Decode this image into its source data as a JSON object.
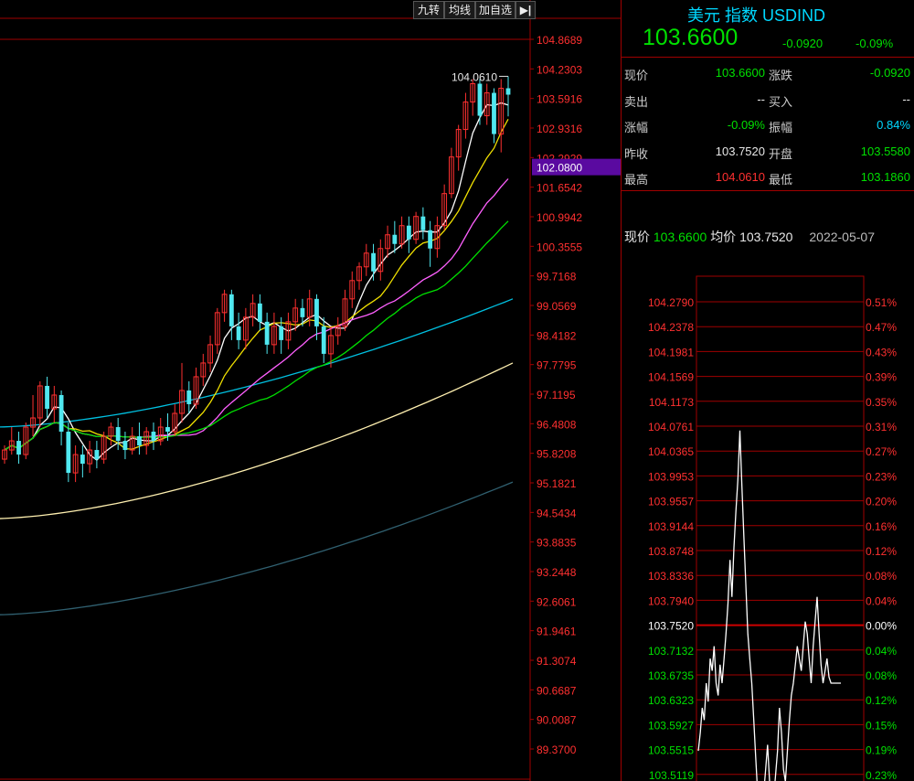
{
  "toolbar": {
    "btn1": "九转",
    "btn2": "均线",
    "btn3": "加自选",
    "btn4": "▶|"
  },
  "header": {
    "title": "美元 指数 USDIND",
    "price": "103.6600",
    "change": "-0.0920",
    "change_pct": "-0.09%"
  },
  "quote": {
    "rows": [
      {
        "l1": "现价",
        "v1": "103.6600",
        "c1": "green",
        "l2": "涨跌",
        "v2": "-0.0920",
        "c2": "green"
      },
      {
        "l1": "卖出",
        "v1": "--",
        "c1": "white",
        "l2": "买入",
        "v2": "--",
        "c2": "white"
      },
      {
        "l1": "涨幅",
        "v1": "-0.09%",
        "c1": "green",
        "l2": "振幅",
        "v2": "0.84%",
        "c2": "cyan"
      },
      {
        "l1": "昨收",
        "v1": "103.7520",
        "c1": "white",
        "l2": "开盘",
        "v2": "103.5580",
        "c2": "green"
      },
      {
        "l1": "最高",
        "v1": "104.0610",
        "c1": "red",
        "l2": "最低",
        "v2": "103.1860",
        "c2": "green"
      }
    ]
  },
  "intraday_header": {
    "now_label": "现价",
    "now_val": "103.6600",
    "avg_label": "均价",
    "avg_val": "103.7520",
    "date": "2022-05-07"
  },
  "colors": {
    "up": "#ff3030",
    "down": "#50e8f0",
    "grid": "#a00000",
    "ma5": "#ffffff",
    "ma10": "#f0e000",
    "ma20": "#ff60ff",
    "ma30": "#00e000",
    "ma60": "#00c0e0",
    "ma120": "#fff0b0",
    "ma250": "#306070"
  },
  "chart_data": [
    {
      "type": "candlestick",
      "title": "",
      "y_ticks": [
        "104.8689",
        "104.2303",
        "103.5916",
        "102.9316",
        "102.2929",
        "101.6542",
        "100.9942",
        "100.3555",
        "99.7168",
        "99.0569",
        "98.4182",
        "97.7795",
        "97.1195",
        "96.4808",
        "95.8208",
        "95.1821",
        "94.5434",
        "93.8835",
        "93.2448",
        "92.6061",
        "91.9461",
        "91.3074",
        "90.6687",
        "90.0087",
        "89.3700"
      ],
      "ylim": [
        89.37,
        104.8689
      ],
      "highlight_label": "102.0800",
      "high_marker": "104.0610",
      "candles": [
        {
          "o": 95.7,
          "c": 95.9,
          "h": 96.0,
          "l": 95.6
        },
        {
          "o": 95.9,
          "c": 96.1,
          "h": 96.4,
          "l": 95.8
        },
        {
          "o": 96.1,
          "c": 95.8,
          "h": 96.3,
          "l": 95.6
        },
        {
          "o": 95.8,
          "c": 96.4,
          "h": 96.5,
          "l": 95.7
        },
        {
          "o": 96.4,
          "c": 96.6,
          "h": 97.1,
          "l": 96.2
        },
        {
          "o": 96.6,
          "c": 97.3,
          "h": 97.4,
          "l": 96.4
        },
        {
          "o": 97.3,
          "c": 96.8,
          "h": 97.5,
          "l": 96.6
        },
        {
          "o": 96.8,
          "c": 97.1,
          "h": 97.3,
          "l": 96.5
        },
        {
          "o": 97.1,
          "c": 96.3,
          "h": 97.2,
          "l": 96.0
        },
        {
          "o": 96.3,
          "c": 95.4,
          "h": 96.5,
          "l": 95.2
        },
        {
          "o": 95.4,
          "c": 95.8,
          "h": 96.0,
          "l": 95.2
        },
        {
          "o": 95.8,
          "c": 95.6,
          "h": 96.0,
          "l": 95.3
        },
        {
          "o": 95.6,
          "c": 95.9,
          "h": 96.1,
          "l": 95.4
        },
        {
          "o": 95.9,
          "c": 95.7,
          "h": 96.1,
          "l": 95.5
        },
        {
          "o": 95.7,
          "c": 96.2,
          "h": 96.3,
          "l": 95.6
        },
        {
          "o": 96.2,
          "c": 96.4,
          "h": 96.5,
          "l": 96.0
        },
        {
          "o": 96.4,
          "c": 96.1,
          "h": 96.6,
          "l": 95.9
        },
        {
          "o": 96.1,
          "c": 95.9,
          "h": 96.3,
          "l": 95.7
        },
        {
          "o": 95.9,
          "c": 96.2,
          "h": 96.4,
          "l": 95.8
        },
        {
          "o": 96.2,
          "c": 96.0,
          "h": 96.5,
          "l": 95.8
        },
        {
          "o": 96.0,
          "c": 96.3,
          "h": 96.4,
          "l": 95.8
        },
        {
          "o": 96.3,
          "c": 96.1,
          "h": 96.5,
          "l": 95.9
        },
        {
          "o": 96.1,
          "c": 96.4,
          "h": 96.6,
          "l": 96.0
        },
        {
          "o": 96.4,
          "c": 96.3,
          "h": 96.7,
          "l": 96.1
        },
        {
          "o": 96.3,
          "c": 96.7,
          "h": 96.9,
          "l": 96.2
        },
        {
          "o": 96.7,
          "c": 97.2,
          "h": 97.8,
          "l": 96.5
        },
        {
          "o": 97.2,
          "c": 96.9,
          "h": 97.4,
          "l": 96.7
        },
        {
          "o": 96.9,
          "c": 97.5,
          "h": 97.7,
          "l": 96.8
        },
        {
          "o": 97.5,
          "c": 97.8,
          "h": 98.0,
          "l": 97.3
        },
        {
          "o": 97.8,
          "c": 98.2,
          "h": 98.4,
          "l": 97.6
        },
        {
          "o": 98.2,
          "c": 98.9,
          "h": 99.0,
          "l": 98.0
        },
        {
          "o": 98.9,
          "c": 99.3,
          "h": 99.4,
          "l": 98.7
        },
        {
          "o": 99.3,
          "c": 98.6,
          "h": 99.4,
          "l": 98.3
        },
        {
          "o": 98.6,
          "c": 98.3,
          "h": 98.9,
          "l": 98.1
        },
        {
          "o": 98.3,
          "c": 98.8,
          "h": 99.0,
          "l": 98.1
        },
        {
          "o": 98.8,
          "c": 99.1,
          "h": 99.3,
          "l": 98.6
        },
        {
          "o": 99.1,
          "c": 98.7,
          "h": 99.3,
          "l": 98.5
        },
        {
          "o": 98.7,
          "c": 98.2,
          "h": 98.9,
          "l": 98.0
        },
        {
          "o": 98.2,
          "c": 98.6,
          "h": 98.9,
          "l": 98.0
        },
        {
          "o": 98.6,
          "c": 98.3,
          "h": 98.8,
          "l": 98.0
        },
        {
          "o": 98.3,
          "c": 98.7,
          "h": 98.9,
          "l": 98.1
        },
        {
          "o": 98.7,
          "c": 99.0,
          "h": 99.2,
          "l": 98.5
        },
        {
          "o": 99.0,
          "c": 98.8,
          "h": 99.2,
          "l": 98.6
        },
        {
          "o": 98.8,
          "c": 99.2,
          "h": 99.4,
          "l": 98.6
        },
        {
          "o": 99.2,
          "c": 98.6,
          "h": 99.3,
          "l": 98.3
        },
        {
          "o": 98.6,
          "c": 98.0,
          "h": 98.8,
          "l": 97.8
        },
        {
          "o": 98.0,
          "c": 98.4,
          "h": 98.6,
          "l": 97.7
        },
        {
          "o": 98.4,
          "c": 98.6,
          "h": 98.8,
          "l": 98.2
        },
        {
          "o": 98.6,
          "c": 99.2,
          "h": 99.4,
          "l": 98.5
        },
        {
          "o": 99.2,
          "c": 99.6,
          "h": 99.8,
          "l": 99.0
        },
        {
          "o": 99.6,
          "c": 99.9,
          "h": 100.0,
          "l": 99.4
        },
        {
          "o": 99.9,
          "c": 100.2,
          "h": 100.4,
          "l": 99.7
        },
        {
          "o": 100.2,
          "c": 99.8,
          "h": 100.4,
          "l": 99.6
        },
        {
          "o": 99.8,
          "c": 100.3,
          "h": 100.5,
          "l": 99.6
        },
        {
          "o": 100.3,
          "c": 100.6,
          "h": 100.8,
          "l": 100.1
        },
        {
          "o": 100.6,
          "c": 100.4,
          "h": 100.9,
          "l": 100.2
        },
        {
          "o": 100.4,
          "c": 100.8,
          "h": 101.0,
          "l": 100.3
        },
        {
          "o": 100.8,
          "c": 100.5,
          "h": 101.0,
          "l": 100.2
        },
        {
          "o": 100.5,
          "c": 101.0,
          "h": 101.1,
          "l": 100.4
        },
        {
          "o": 101.0,
          "c": 100.7,
          "h": 101.2,
          "l": 100.5
        },
        {
          "o": 100.7,
          "c": 100.3,
          "h": 100.9,
          "l": 99.9
        },
        {
          "o": 100.3,
          "c": 100.8,
          "h": 101.0,
          "l": 100.1
        },
        {
          "o": 100.8,
          "c": 101.5,
          "h": 101.7,
          "l": 100.7
        },
        {
          "o": 101.5,
          "c": 102.3,
          "h": 102.5,
          "l": 101.4
        },
        {
          "o": 102.3,
          "c": 102.9,
          "h": 103.0,
          "l": 102.0
        },
        {
          "o": 102.9,
          "c": 103.5,
          "h": 103.7,
          "l": 102.7
        },
        {
          "o": 103.5,
          "c": 103.9,
          "h": 104.0,
          "l": 103.2
        },
        {
          "o": 103.9,
          "c": 103.2,
          "h": 104.0,
          "l": 103.0
        },
        {
          "o": 103.2,
          "c": 103.7,
          "h": 103.9,
          "l": 103.0
        },
        {
          "o": 103.7,
          "c": 102.8,
          "h": 103.8,
          "l": 102.6
        },
        {
          "o": 102.8,
          "c": 103.8,
          "h": 104.0,
          "l": 102.4
        },
        {
          "o": 103.8,
          "c": 103.66,
          "h": 104.061,
          "l": 103.186
        }
      ]
    },
    {
      "type": "line",
      "title": "",
      "y_ticks_left": [
        "104.2790",
        "104.2378",
        "104.1981",
        "104.1569",
        "104.1173",
        "104.0761",
        "104.0365",
        "103.9953",
        "103.9557",
        "103.9144",
        "103.8748",
        "103.8336",
        "103.7940",
        "103.7520",
        "103.7132",
        "103.6735",
        "103.6323",
        "103.5927",
        "103.5515",
        "103.5119"
      ],
      "y_ticks_right": [
        "0.51%",
        "0.47%",
        "0.43%",
        "0.39%",
        "0.35%",
        "0.31%",
        "0.27%",
        "0.23%",
        "0.20%",
        "0.16%",
        "0.12%",
        "0.08%",
        "0.04%",
        "0.00%",
        "0.04%",
        "0.08%",
        "0.12%",
        "0.15%",
        "0.19%",
        "0.23%"
      ],
      "ylim": [
        103.49,
        104.29
      ],
      "prev_close": 103.752,
      "values": [
        103.55,
        103.58,
        103.62,
        103.6,
        103.66,
        103.63,
        103.7,
        103.68,
        103.72,
        103.66,
        103.64,
        103.69,
        103.66,
        103.7,
        103.74,
        103.79,
        103.86,
        103.8,
        103.88,
        103.94,
        103.99,
        104.07,
        103.98,
        103.9,
        103.82,
        103.74,
        103.7,
        103.66,
        103.6,
        103.54,
        103.48,
        103.46,
        103.44,
        103.48,
        103.52,
        103.56,
        103.5,
        103.45,
        103.47,
        103.51,
        103.55,
        103.62,
        103.58,
        103.52,
        103.5,
        103.55,
        103.6,
        103.64,
        103.66,
        103.69,
        103.72,
        103.7,
        103.68,
        103.72,
        103.76,
        103.74,
        103.7,
        103.66,
        103.72,
        103.76,
        103.8,
        103.74,
        103.69,
        103.66,
        103.68,
        103.7,
        103.67,
        103.66,
        103.66,
        103.66,
        103.66,
        103.66,
        103.66
      ]
    }
  ]
}
